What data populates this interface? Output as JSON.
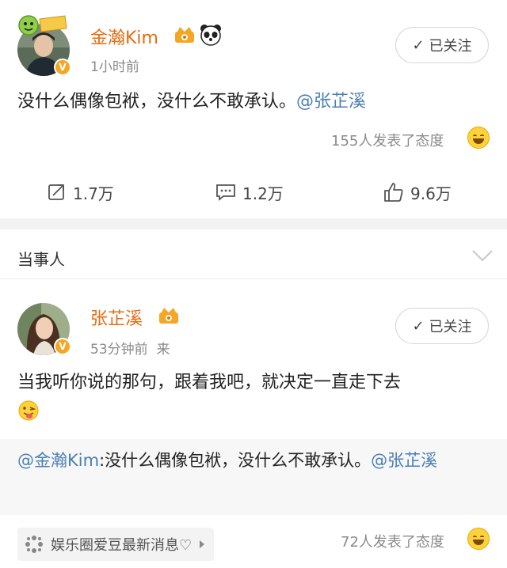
{
  "post1": {
    "author": "金瀚Kim",
    "time": "1小时前",
    "follow_label": "已关注",
    "content_text": "没什么偶像包袱，没什么不敢承认。",
    "content_mention": "@张芷溪",
    "reactions": "155人发表了态度",
    "actions": {
      "repost": "1.7万",
      "comment": "1.2万",
      "like": "9.6万"
    },
    "avatar_badge": "V"
  },
  "section": {
    "title": "当事人"
  },
  "post2": {
    "author": "张芷溪",
    "time": "53分钟前",
    "source_prefix": "来",
    "follow_label": "已关注",
    "content_text": "当我听你说的那句，跟着我吧，就决定一直走下去",
    "quote_mention": "@金瀚Kim",
    "quote_text": ":没什么偶像包袱，没什么不敢承认。",
    "quote_mention2": "@张芷溪",
    "avatar_badge": "V",
    "source_label": "娱乐圈爱豆最新消息♡",
    "reactions": "72人发表了态度"
  },
  "colors": {
    "name": "#e86b10",
    "mention": "#4a7fb5",
    "muted": "#8a8a8a"
  }
}
